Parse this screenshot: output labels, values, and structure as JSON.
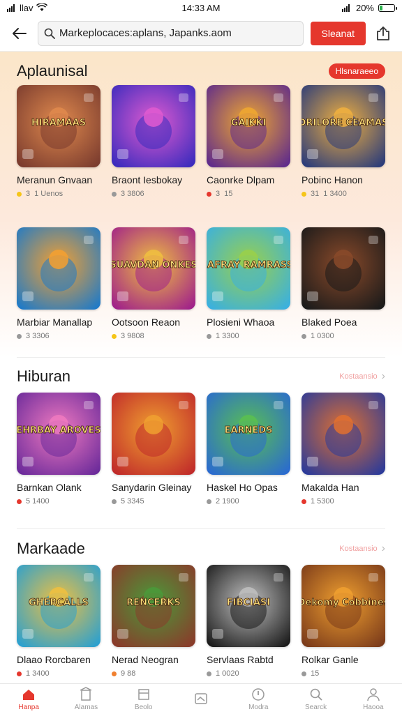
{
  "status": {
    "carrier": "llav",
    "time": "14:33 AM",
    "battery": "20%",
    "battery_level": 0.2
  },
  "header": {
    "search_value": "Markeplocaces:aplans, Japanks.aom",
    "search_button": "Sleanat"
  },
  "sections": [
    {
      "title": "Aplaunisal",
      "badge": "Hlsnaraeeo",
      "items": [
        {
          "title": "Meranun Gnvaan",
          "rating": "3",
          "meta": "1 Uenos",
          "art_text": "HIRAMAAS",
          "colors": [
            "#7a3b2e",
            "#e08a4e"
          ],
          "dot": "#f5c518"
        },
        {
          "title": "Braont Iesbokay",
          "rating": "",
          "meta": "3 3806",
          "art_text": "",
          "colors": [
            "#3a2bbd",
            "#e05bd0"
          ],
          "dot": "#999999"
        },
        {
          "title": "Caonrke Dlpam",
          "rating": "3",
          "meta": "15",
          "art_text": "GAIKKI",
          "colors": [
            "#5e2a8c",
            "#f0a830"
          ],
          "dot": "#e5372d"
        },
        {
          "title": "Pobinc Hanon",
          "rating": "31",
          "meta": "1 3400",
          "art_text": "DRILORE CEAMAS",
          "colors": [
            "#2a3b7a",
            "#f0b040"
          ],
          "dot": "#f5c518"
        },
        {
          "title": "Marbiar Manallap",
          "rating": "",
          "meta": "3 3306",
          "art_text": "",
          "colors": [
            "#1e7ac8",
            "#f5a030"
          ],
          "dot": "#999999"
        },
        {
          "title": "Ootsoon Reaon",
          "rating": "",
          "meta": "3 9808",
          "art_text": "SUAVDAN ONKES",
          "colors": [
            "#a0208a",
            "#f0c040"
          ],
          "dot": "#f5c518"
        },
        {
          "title": "Plosieni Whaoa",
          "rating": "",
          "meta": "1 3300",
          "art_text": "JAFRAY RAMRASS",
          "colors": [
            "#3ab0e0",
            "#9ad04a"
          ],
          "dot": "#999999"
        },
        {
          "title": "Blaked Poea",
          "rating": "",
          "meta": "1 0300",
          "art_text": "",
          "colors": [
            "#1a1a1a",
            "#8a4a2a"
          ],
          "dot": "#999999"
        }
      ]
    },
    {
      "title": "Hiburan",
      "badge": "Kostaansio",
      "items": [
        {
          "title": "Barnkan Olank",
          "rating": "",
          "meta": "5 1400",
          "art_text": "EHRBAY AROVES",
          "colors": [
            "#6a2a9a",
            "#f07ac0"
          ],
          "dot": "#e5372d"
        },
        {
          "title": "Sanydarin Gleinay",
          "rating": "",
          "meta": "5 3345",
          "art_text": "",
          "colors": [
            "#c02a2a",
            "#f0a030"
          ],
          "dot": "#999999"
        },
        {
          "title": "Haskel Ho Opas",
          "rating": "",
          "meta": "2 1900",
          "art_text": "EARNEDS",
          "colors": [
            "#2a6ad0",
            "#5ac050"
          ],
          "dot": "#999999"
        },
        {
          "title": "Makalda Han",
          "rating": "",
          "meta": "1 5300",
          "art_text": "",
          "colors": [
            "#2a3a9a",
            "#e07030"
          ],
          "dot": "#e5372d"
        }
      ]
    },
    {
      "title": "Markaade",
      "badge": "Kostaansio",
      "items": [
        {
          "title": "Dlaao Rorcbaren",
          "rating": "",
          "meta": "1 3400",
          "art_text": "GHERCALLS",
          "colors": [
            "#2aa0d0",
            "#f0c040"
          ],
          "dot": "#e5372d"
        },
        {
          "title": "Nerad Neogran",
          "rating": "",
          "meta": "9 88",
          "art_text": "RENCERKS",
          "colors": [
            "#8a3a2a",
            "#4a9a3a"
          ],
          "dot": "#f08030"
        },
        {
          "title": "Servlaas Rabtd",
          "rating": "",
          "meta": "1 0020",
          "art_text": "FIBCIASI",
          "colors": [
            "#1a1a1a",
            "#c0c0c0"
          ],
          "dot": "#999999"
        },
        {
          "title": "Rolkar Ganle",
          "rating": "",
          "meta": "15",
          "art_text": "Dekomy Cobbines",
          "colors": [
            "#7a3a1a",
            "#f0a030"
          ],
          "dot": "#999999"
        }
      ]
    }
  ],
  "bottom_nav": [
    {
      "label": "Hanpa",
      "icon": "home-icon",
      "active": true
    },
    {
      "label": "Alamas",
      "icon": "building-icon",
      "active": false
    },
    {
      "label": "Beolo",
      "icon": "book-icon",
      "active": false
    },
    {
      "label": "",
      "icon": "image-icon",
      "active": false
    },
    {
      "label": "Modra",
      "icon": "circle-icon",
      "active": false
    },
    {
      "label": "Searck",
      "icon": "search-icon",
      "active": false
    },
    {
      "label": "Haooa",
      "icon": "profile-icon",
      "active": false
    }
  ],
  "colors": {
    "accent": "#e5372d",
    "badge_bg": "#e5372d"
  }
}
